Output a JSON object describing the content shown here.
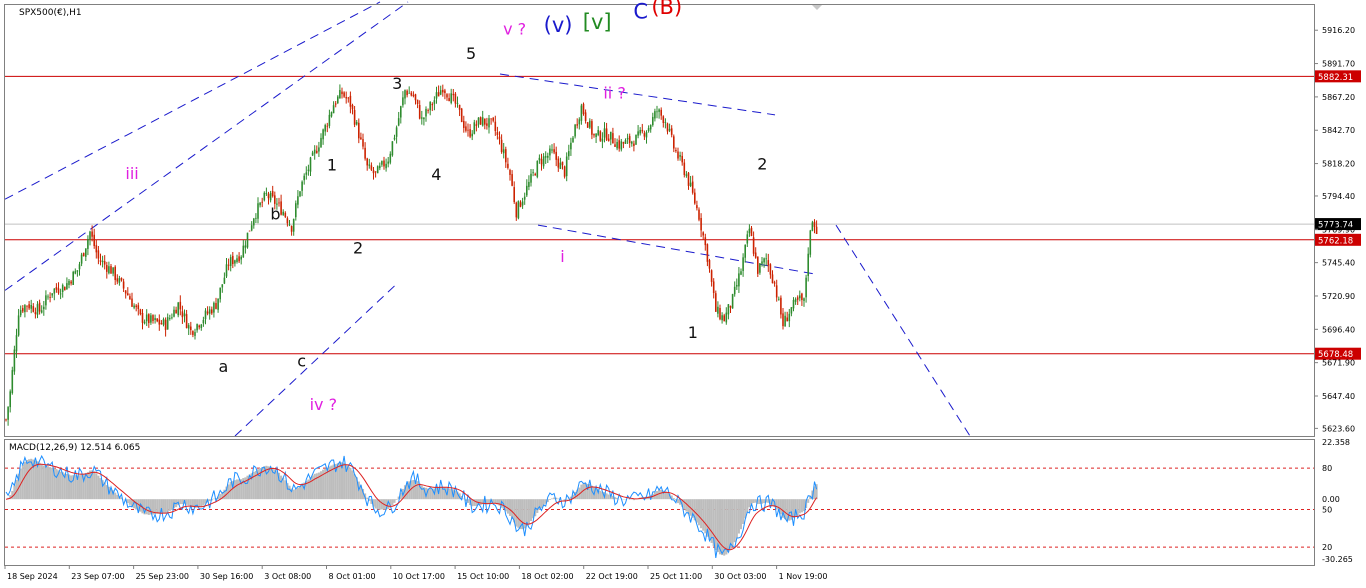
{
  "chart_data": [
    {
      "type": "candlestick",
      "title": "SPX500(€),H1",
      "symbol": "SPX500(€)",
      "timeframe": "H1",
      "ylim": [
        5618,
        5934
      ],
      "price_ticks": [
        5916.2,
        5891.7,
        5867.2,
        5842.7,
        5818.2,
        5794.4,
        5769.9,
        5745.4,
        5720.9,
        5696.4,
        5671.9,
        5647.4,
        5623.6
      ],
      "price_tick_labels": [
        "5916.20",
        "5891.70",
        "5867.20",
        "5842.70",
        "5818.20",
        "5794.40",
        "5769.90",
        "5745.40",
        "5720.90",
        "5696.40",
        "5671.90",
        "5647.40",
        "5623.60"
      ],
      "horizontal_levels": [
        {
          "value": 5882.31,
          "label": "5882.31",
          "color": "#cc0000"
        },
        {
          "value": 5762.18,
          "label": "5762.18",
          "color": "#cc0000"
        },
        {
          "value": 5678.48,
          "label": "5678.48",
          "color": "#cc0000"
        }
      ],
      "current_price": {
        "value": 5773.74,
        "label": "5773.74",
        "color": "#000000"
      },
      "colors": {
        "bull": "#2e8b2e",
        "bear": "#cc2200",
        "level": "#cc0000",
        "trendline": "#1a1acc",
        "grid": "#b4b4b4",
        "current_price_line": "#c0c0c0"
      },
      "x_tick_labels": [
        "18 Sep 2024",
        "23 Sep 07:00",
        "25 Sep 23:00",
        "30 Sep 16:00",
        "3 Oct 08:00",
        "8 Oct 01:00",
        "10 Oct 17:00",
        "15 Oct 10:00",
        "18 Oct 02:00",
        "22 Oct 19:00",
        "25 Oct 11:00",
        "30 Oct 03:00",
        "1 Nov 19:00"
      ],
      "close_path": [
        [
          0,
          5630
        ],
        [
          2,
          5650
        ],
        [
          6,
          5710
        ],
        [
          10,
          5715
        ],
        [
          16,
          5710
        ],
        [
          22,
          5725
        ],
        [
          28,
          5728
        ],
        [
          34,
          5740
        ],
        [
          40,
          5768
        ],
        [
          44,
          5748
        ],
        [
          50,
          5740
        ],
        [
          58,
          5722
        ],
        [
          64,
          5705
        ],
        [
          70,
          5702
        ],
        [
          76,
          5700
        ],
        [
          82,
          5715
        ],
        [
          88,
          5695
        ],
        [
          94,
          5705
        ],
        [
          100,
          5715
        ],
        [
          106,
          5745
        ],
        [
          112,
          5752
        ],
        [
          118,
          5780
        ],
        [
          124,
          5795
        ],
        [
          128,
          5790
        ],
        [
          132,
          5783
        ],
        [
          136,
          5772
        ],
        [
          140,
          5800
        ],
        [
          146,
          5822
        ],
        [
          152,
          5845
        ],
        [
          156,
          5862
        ],
        [
          160,
          5870
        ],
        [
          164,
          5862
        ],
        [
          168,
          5840
        ],
        [
          172,
          5815
        ],
        [
          176,
          5810
        ],
        [
          182,
          5822
        ],
        [
          186,
          5845
        ],
        [
          190,
          5872
        ],
        [
          194,
          5868
        ],
        [
          198,
          5850
        ],
        [
          202,
          5860
        ],
        [
          208,
          5875
        ],
        [
          214,
          5862
        ],
        [
          220,
          5840
        ],
        [
          226,
          5850
        ],
        [
          232,
          5846
        ],
        [
          236,
          5830
        ],
        [
          240,
          5810
        ],
        [
          243,
          5783
        ],
        [
          248,
          5800
        ],
        [
          254,
          5820
        ],
        [
          260,
          5826
        ],
        [
          266,
          5812
        ],
        [
          270,
          5840
        ],
        [
          274,
          5860
        ],
        [
          280,
          5838
        ],
        [
          286,
          5840
        ],
        [
          292,
          5832
        ],
        [
          300,
          5836
        ],
        [
          306,
          5845
        ],
        [
          310,
          5857
        ],
        [
          314,
          5850
        ],
        [
          318,
          5830
        ],
        [
          324,
          5810
        ],
        [
          330,
          5780
        ],
        [
          334,
          5750
        ],
        [
          338,
          5710
        ],
        [
          342,
          5704
        ],
        [
          346,
          5718
        ],
        [
          350,
          5740
        ],
        [
          354,
          5770
        ],
        [
          358,
          5740
        ],
        [
          362,
          5748
        ],
        [
          366,
          5730
        ],
        [
          370,
          5700
        ],
        [
          374,
          5712
        ],
        [
          378,
          5718
        ],
        [
          380,
          5716
        ],
        [
          382,
          5755
        ],
        [
          384,
          5778
        ],
        [
          386,
          5770
        ]
      ]
    },
    {
      "type": "macd",
      "title": "MACD(12,26,9) 12.514 6.065",
      "params": "12,26,9",
      "macd_value": 12.514,
      "signal_value": 6.065,
      "ylim": [
        -35,
        32
      ],
      "y_ticks": [
        22.358,
        0.0,
        -30.265
      ],
      "y_tick_labels": [
        "22.358",
        "0.00",
        "-30.265"
      ],
      "level_labels": [
        "80",
        "50",
        "20"
      ],
      "levels": [
        16.5,
        -5.5,
        -25.5
      ],
      "colors": {
        "main": "#1e8fff",
        "signal": "#dd2222",
        "histogram": "#bdbdbd",
        "levels": "#dd2222"
      }
    }
  ],
  "wave_labels": [
    {
      "text": "(B)",
      "color": "#e00000",
      "x": 152,
      "y": 5928
    },
    {
      "text": "C",
      "color": "#1a1acc",
      "x": 146,
      "y": 5925
    },
    {
      "text": "[v]",
      "color": "#228b22",
      "x": 136,
      "y": 5917
    },
    {
      "text": "(v)",
      "color": "#1a1acc",
      "x": 127,
      "y": 5915
    },
    {
      "text": "v ?",
      "color": "#e020e0",
      "x": 117,
      "y": 5913
    },
    {
      "text": "5",
      "color": "#111111",
      "x": 107,
      "y": 5895
    },
    {
      "text": "3",
      "color": "#111111",
      "x": 90,
      "y": 5873
    },
    {
      "text": "ii ?",
      "color": "#e020e0",
      "x": 140,
      "y": 5866
    },
    {
      "text": "iii",
      "color": "#e020e0",
      "x": 29,
      "y": 5807
    },
    {
      "text": "1",
      "color": "#111111",
      "x": 75,
      "y": 5813
    },
    {
      "text": "4",
      "color": "#111111",
      "x": 99,
      "y": 5806
    },
    {
      "text": "2",
      "color": "#111111",
      "x": 174,
      "y": 5814
    },
    {
      "text": "b",
      "color": "#111111",
      "x": 62,
      "y": 5777
    },
    {
      "text": "2",
      "color": "#111111",
      "x": 81,
      "y": 5752
    },
    {
      "text": "i",
      "color": "#e020e0",
      "x": 128,
      "y": 5746
    },
    {
      "text": "1",
      "color": "#111111",
      "x": 158,
      "y": 5690
    },
    {
      "text": "a",
      "color": "#111111",
      "x": 50,
      "y": 5665
    },
    {
      "text": "c",
      "color": "#111111",
      "x": 68,
      "y": 5669
    },
    {
      "text": "iv ?",
      "color": "#e020e0",
      "x": 73,
      "y": 5637
    }
  ]
}
